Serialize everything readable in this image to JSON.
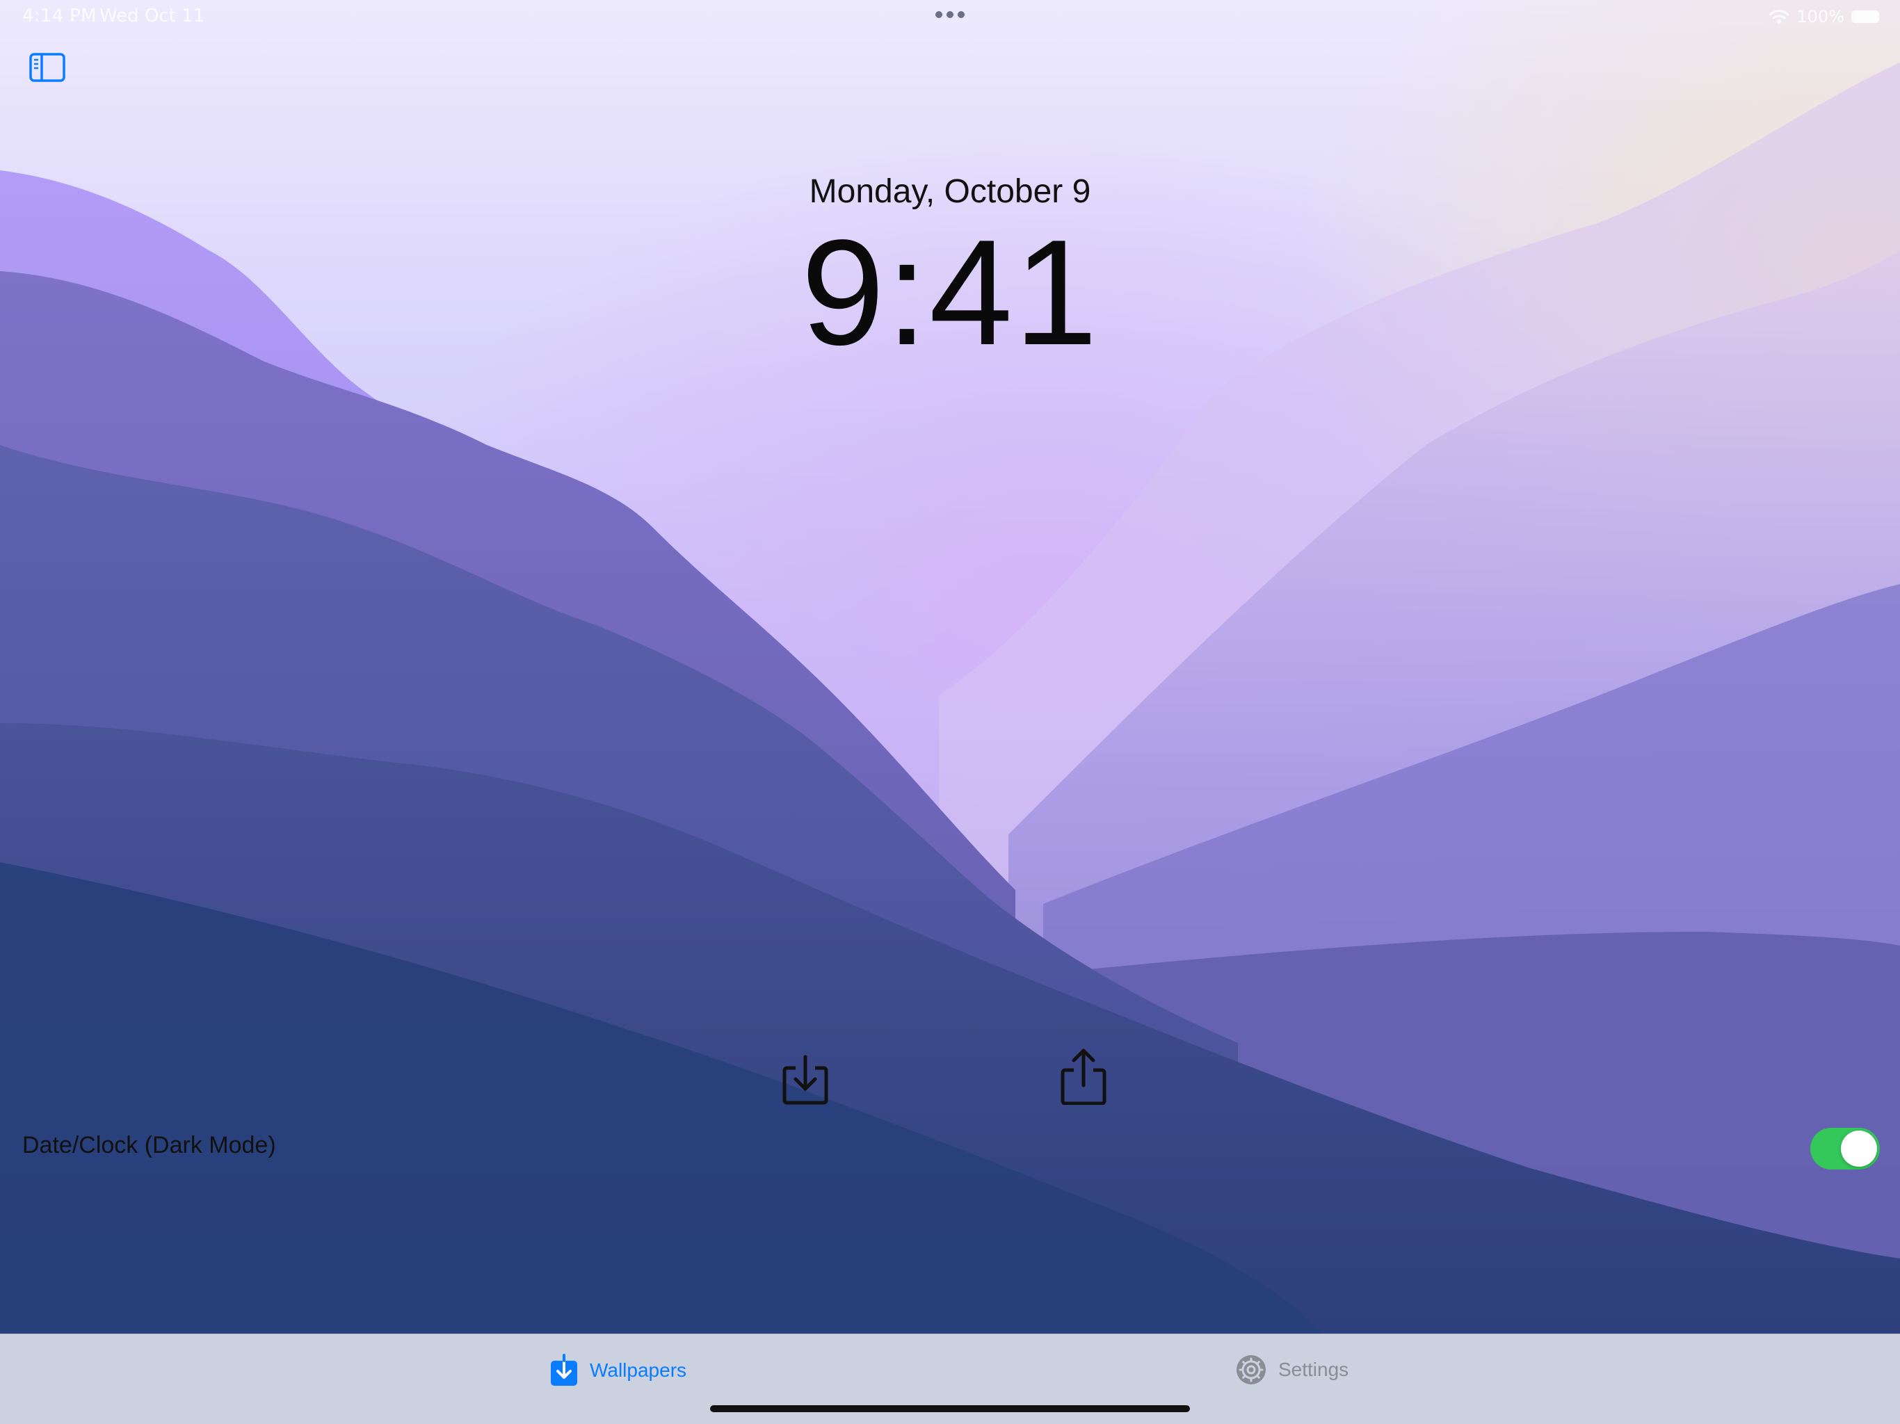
{
  "status_bar": {
    "time": "4:14 PM",
    "date": "Wed Oct 11",
    "battery": "100%"
  },
  "lock_screen": {
    "date": "Monday, October 9",
    "time": "9:41"
  },
  "controls": {
    "dark_mode_label": "Date/Clock (Dark Mode)",
    "dark_mode_enabled": true
  },
  "tab_bar": {
    "tabs": [
      {
        "label": "Wallpapers",
        "icon": "download-square-icon",
        "selected": true
      },
      {
        "label": "Settings",
        "icon": "gear-icon",
        "selected": false
      }
    ]
  },
  "colors": {
    "accent": "#0a7cff",
    "toggle_on": "#34c759",
    "tab_bar_bg": "#ccd1e0"
  }
}
